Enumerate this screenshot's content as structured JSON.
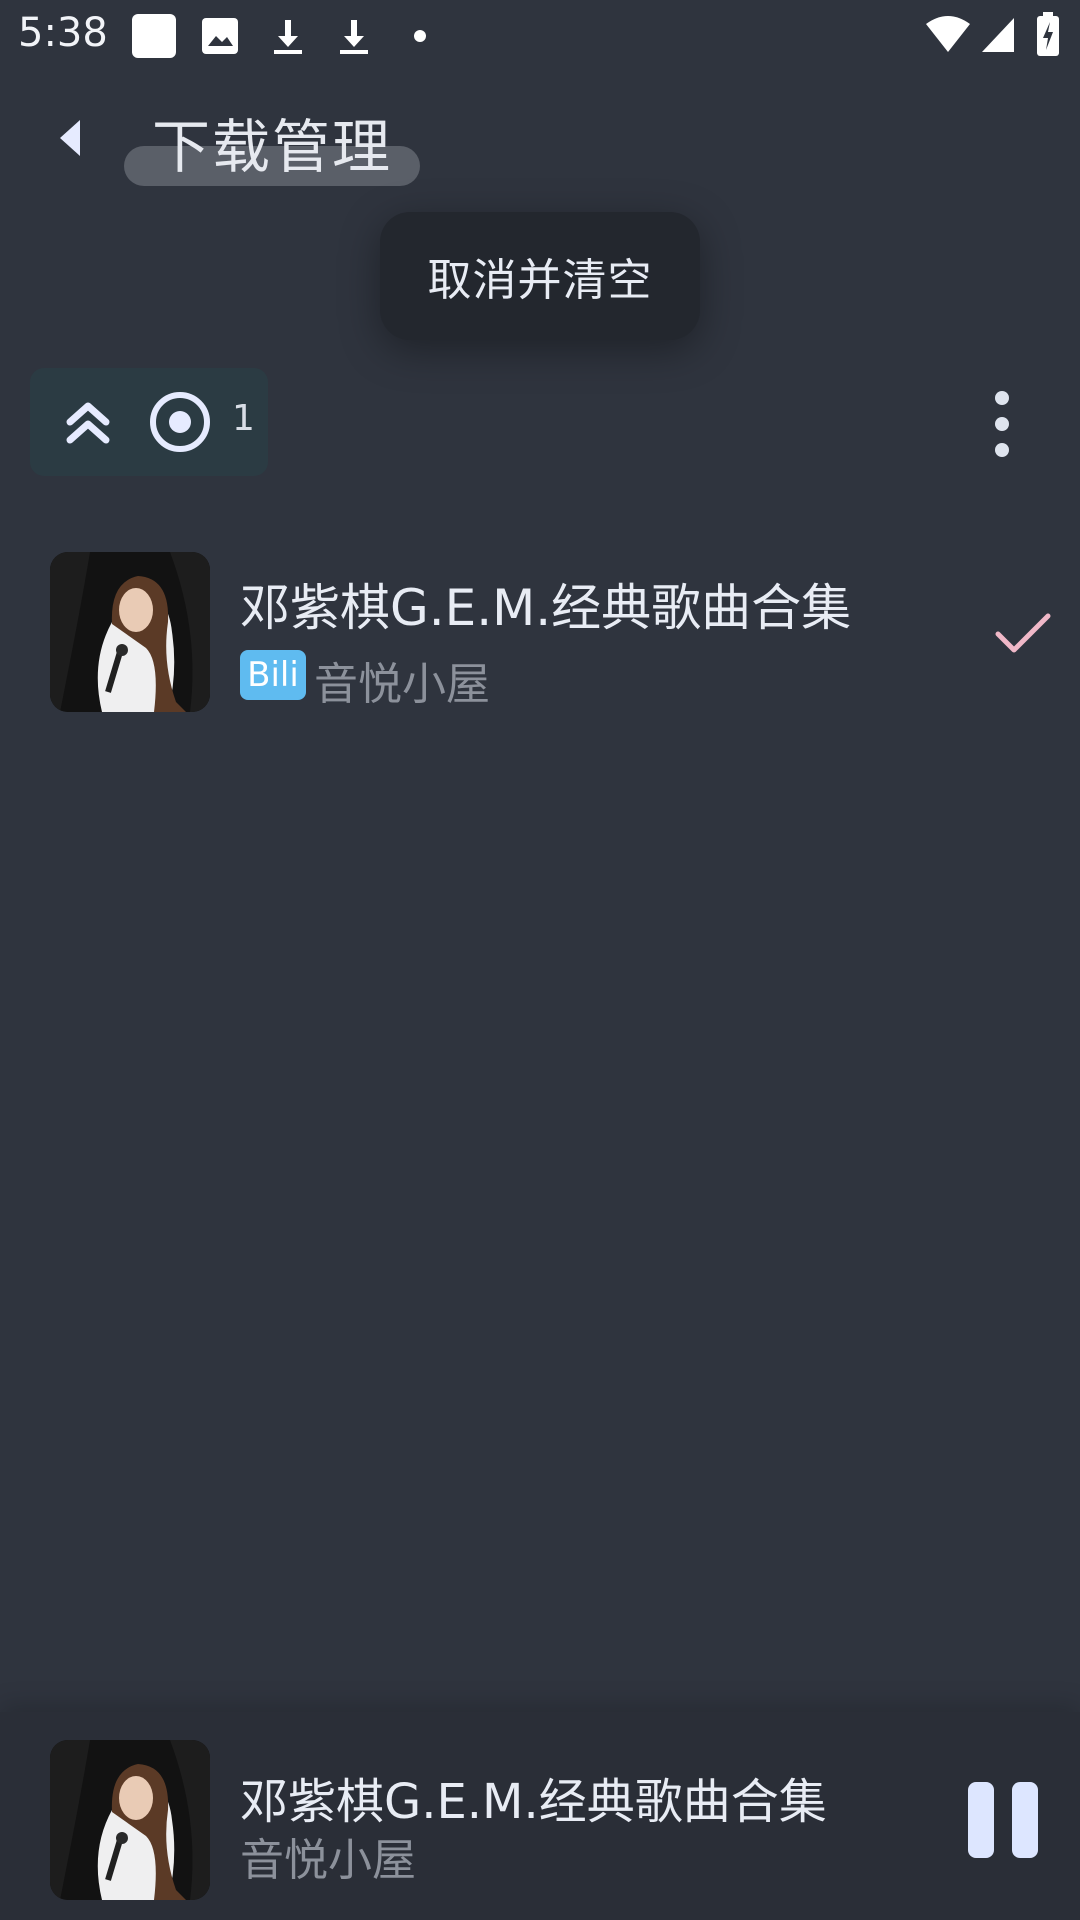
{
  "status_bar": {
    "time": "5:38",
    "icons": [
      "app-square-icon",
      "image-icon",
      "download-icon",
      "download-icon",
      "dot-icon",
      "wifi-icon",
      "signal-icon",
      "battery-charging-icon"
    ]
  },
  "header": {
    "title": "下载管理",
    "back_icon": "chevron-left-icon"
  },
  "popup": {
    "label": "取消并清空"
  },
  "filter_chip": {
    "up_icon": "double-chevron-up-icon",
    "radio_icon": "radio-icon",
    "count": "1"
  },
  "more_icon": "more-vertical-icon",
  "downloads": [
    {
      "title": "邓紫棋G.E.M.经典歌曲合集",
      "source_badge": "Bili",
      "author": "音悦小屋",
      "status_icon": "check-icon"
    }
  ],
  "player": {
    "title": "邓紫棋G.E.M.经典歌曲合集",
    "artist": "音悦小屋",
    "control_icon": "pause-icon"
  },
  "colors": {
    "background": "#2f343e",
    "chip": "#2b3b43",
    "badge": "#5fbbf0",
    "check": "#f0b8c8",
    "pause": "#dde6ff"
  }
}
